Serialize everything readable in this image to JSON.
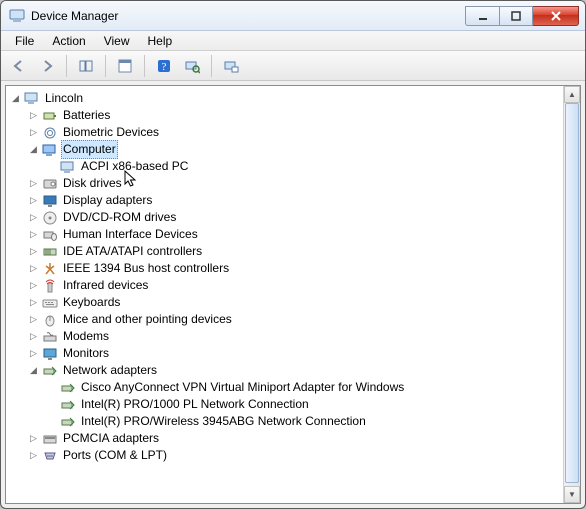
{
  "window": {
    "title": "Device Manager"
  },
  "menu": {
    "file": "File",
    "action": "Action",
    "view": "View",
    "help": "Help"
  },
  "tree": {
    "root": "Lincoln",
    "batteries": "Batteries",
    "biometric": "Biometric Devices",
    "computer": "Computer",
    "computer_child": "ACPI x86-based PC",
    "disk": "Disk drives",
    "display": "Display adapters",
    "dvd": "DVD/CD-ROM drives",
    "hid": "Human Interface Devices",
    "ide": "IDE ATA/ATAPI controllers",
    "ieee": "IEEE 1394 Bus host controllers",
    "infrared": "Infrared devices",
    "keyboards": "Keyboards",
    "mice": "Mice and other pointing devices",
    "modems": "Modems",
    "monitors": "Monitors",
    "network": "Network adapters",
    "net1": "Cisco AnyConnect VPN Virtual Miniport Adapter for Windows",
    "net2": "Intel(R) PRO/1000 PL Network Connection",
    "net3": "Intel(R) PRO/Wireless 3945ABG Network Connection",
    "pcmcia": "PCMCIA adapters",
    "ports": "Ports (COM & LPT)"
  },
  "icons": {
    "app": "computer-tree-icon",
    "back": "back-arrow-icon",
    "forward": "forward-arrow-icon",
    "show": "show-hide-icon",
    "properties": "properties-icon",
    "help": "help-icon",
    "scan": "scan-icon",
    "enable": "device-config-icon"
  }
}
